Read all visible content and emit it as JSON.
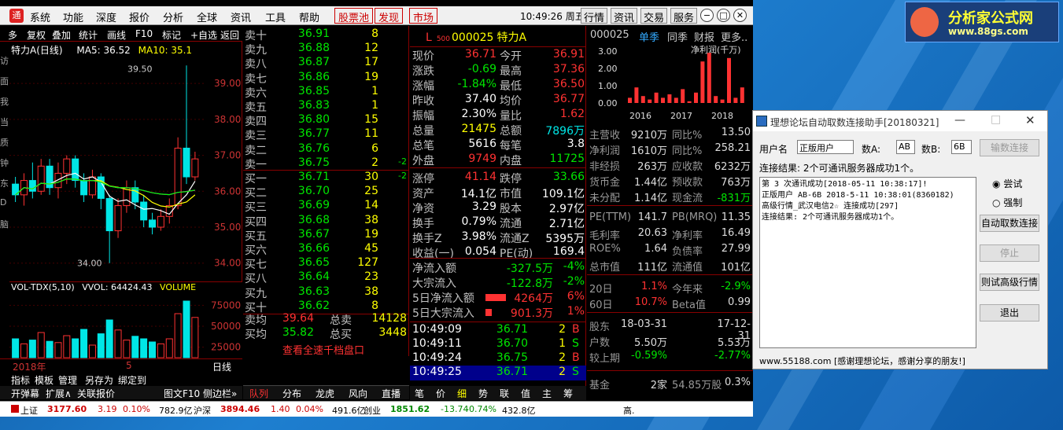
{
  "brand": {
    "name": "分析家公式网",
    "url": "www.88gs.com"
  },
  "menu": {
    "items": [
      "系统",
      "功能",
      "深度",
      "报价",
      "分析",
      "全球",
      "资讯",
      "工具",
      "帮助"
    ],
    "red_boxes": [
      "股票池",
      "发现",
      "市场"
    ],
    "time": "10:49:26 周五",
    "right_buttons": [
      "行情",
      "资讯",
      "交易",
      "服务"
    ]
  },
  "chart_toolbar": [
    "多",
    "复权",
    "叠加",
    "统计",
    "画线",
    "F10",
    "标记",
    "+自选",
    "返回"
  ],
  "left_strip": [
    "访",
    "面",
    "我",
    "当",
    "质",
    "钟",
    "东",
    "D",
    "脑"
  ],
  "kline": {
    "title": "特力A(日线)",
    "ma5_label": "MA5: 36.52",
    "ma10_label": "MA10: 35.1",
    "high_label": "39.50",
    "low_label": "34.00",
    "yticks": [
      "39.00",
      "38.00",
      "37.00",
      "36.00",
      "35.00",
      "34.00"
    ],
    "ylim": [
      33.6,
      39.9
    ]
  },
  "chart_data": {
    "type": "candlestick",
    "title": "特力A(日线)",
    "candles": [
      {
        "o": 36.2,
        "c": 35.9,
        "h": 36.4,
        "l": 35.7
      },
      {
        "o": 35.9,
        "c": 36.3,
        "h": 36.5,
        "l": 35.6
      },
      {
        "o": 36.3,
        "c": 36.0,
        "h": 36.8,
        "l": 35.8
      },
      {
        "o": 36.0,
        "c": 36.7,
        "h": 36.9,
        "l": 35.9
      },
      {
        "o": 36.7,
        "c": 36.1,
        "h": 36.9,
        "l": 35.9
      },
      {
        "o": 36.1,
        "c": 36.5,
        "h": 36.8,
        "l": 35.8
      },
      {
        "o": 36.5,
        "c": 36.9,
        "h": 37.0,
        "l": 36.2
      },
      {
        "o": 36.9,
        "c": 36.3,
        "h": 37.0,
        "l": 36.1
      },
      {
        "o": 36.3,
        "c": 35.9,
        "h": 36.5,
        "l": 35.7
      },
      {
        "o": 35.9,
        "c": 36.4,
        "h": 36.6,
        "l": 35.8
      },
      {
        "o": 36.4,
        "c": 35.8,
        "h": 36.5,
        "l": 35.5
      },
      {
        "o": 35.8,
        "c": 34.9,
        "h": 35.9,
        "l": 34.0
      },
      {
        "o": 34.9,
        "c": 35.6,
        "h": 35.8,
        "l": 34.7
      },
      {
        "o": 35.6,
        "c": 36.1,
        "h": 36.3,
        "l": 35.4
      },
      {
        "o": 36.1,
        "c": 35.7,
        "h": 36.3,
        "l": 35.5
      },
      {
        "o": 35.7,
        "c": 35.2,
        "h": 35.9,
        "l": 35.0
      },
      {
        "o": 35.2,
        "c": 35.0,
        "h": 35.4,
        "l": 34.8
      },
      {
        "o": 35.0,
        "c": 35.3,
        "h": 35.5,
        "l": 34.9
      },
      {
        "o": 35.3,
        "c": 35.6,
        "h": 35.8,
        "l": 35.1
      },
      {
        "o": 35.6,
        "c": 37.2,
        "h": 37.5,
        "l": 35.5
      },
      {
        "o": 37.2,
        "c": 36.4,
        "h": 39.5,
        "l": 36.2
      },
      {
        "o": 36.4,
        "c": 36.9,
        "h": 37.1,
        "l": 36.3
      }
    ],
    "vol": {
      "label": "VOL-TDX(5,10)",
      "vvol": "VVOL: 64424.43",
      "extra": "VOLUME",
      "values": [
        30,
        22,
        28,
        40,
        26,
        24,
        35,
        30,
        45,
        20,
        38,
        60,
        44,
        28,
        34,
        30,
        25,
        22,
        30,
        70,
        90,
        64
      ],
      "yticks": [
        "75000",
        "50000",
        "25000"
      ]
    }
  },
  "chart_bottom": {
    "date": "2018年",
    "mark": "5",
    "period": "日线"
  },
  "chart_tabs": [
    "指标",
    "模板",
    "管理",
    "另存为",
    "绑定到"
  ],
  "chart_tabs2": [
    "开弹幕",
    "扩展∧",
    "关联报价",
    "图文F10",
    "侧边栏»"
  ],
  "book": {
    "asks": [
      [
        "卖十",
        "36.91",
        "8"
      ],
      [
        "卖九",
        "36.88",
        "12"
      ],
      [
        "卖八",
        "36.87",
        "17"
      ],
      [
        "卖七",
        "36.86",
        "19"
      ],
      [
        "卖六",
        "36.85",
        "1"
      ],
      [
        "卖五",
        "36.83",
        "1"
      ],
      [
        "卖四",
        "36.80",
        "15"
      ],
      [
        "卖三",
        "36.77",
        "11"
      ],
      [
        "卖二",
        "36.76",
        "6"
      ],
      [
        "卖一",
        "36.75",
        "2",
        "-2"
      ]
    ],
    "bids": [
      [
        "买一",
        "36.71",
        "30",
        "-2"
      ],
      [
        "买二",
        "36.70",
        "25"
      ],
      [
        "买三",
        "36.69",
        "14"
      ],
      [
        "买四",
        "36.68",
        "38"
      ],
      [
        "买五",
        "36.67",
        "19"
      ],
      [
        "买六",
        "36.66",
        "45"
      ],
      [
        "买七",
        "36.65",
        "127"
      ],
      [
        "买八",
        "36.64",
        "23"
      ],
      [
        "买九",
        "36.63",
        "38"
      ],
      [
        "买十",
        "36.62",
        "8"
      ]
    ],
    "avg_sell": {
      "label": "卖均",
      "price": "39.64",
      "tlabel": "总卖",
      "vol": "14128"
    },
    "avg_buy": {
      "label": "买均",
      "price": "35.82",
      "tlabel": "总买",
      "vol": "3448"
    },
    "link": "查看全速千档盘口"
  },
  "book_tabs": [
    "队列",
    "分布",
    "龙虎",
    "风向",
    "直播"
  ],
  "quote": {
    "code": "000025",
    "name": "特力A",
    "prefix": "L",
    "sub": "500",
    "rows": [
      [
        "现价",
        "36.71",
        "今开",
        "36.91"
      ],
      [
        "涨跌",
        "-0.69",
        "最高",
        "37.36"
      ],
      [
        "涨幅",
        "-1.84%",
        "最低",
        "36.50"
      ],
      [
        "昨收",
        "37.40",
        "均价",
        "36.77"
      ],
      [
        "振幅",
        "2.30%",
        "量比",
        "1.62"
      ],
      [
        "总量",
        "21475",
        "总额",
        "7896万"
      ],
      [
        "总笔",
        "5616",
        "每笔",
        "3.8"
      ],
      [
        "外盘",
        "9749",
        "内盘",
        "11725"
      ],
      [
        "涨停",
        "41.14",
        "跌停",
        "33.66"
      ],
      [
        "资产",
        "14.1亿",
        "市值",
        "109.1亿"
      ],
      [
        "净资",
        "3.29",
        "股本",
        "2.97亿"
      ],
      [
        "换手",
        "0.79%",
        "流通",
        "2.71亿"
      ],
      [
        "换手Z",
        "3.98%",
        "流通Z",
        "5395万"
      ],
      [
        "收益(一)",
        "0.054",
        "PE(动)",
        "169.4"
      ]
    ],
    "flow": [
      [
        "净流入额",
        "-327.5万",
        "-4%"
      ],
      [
        "大宗流入",
        "-122.8万",
        "-2%"
      ],
      [
        "5日净流入额",
        "4264万",
        "6%"
      ],
      [
        "5日大宗流入",
        "901.3万",
        "1%"
      ]
    ],
    "ticks": [
      [
        "10:49:09",
        "36.71",
        "2",
        "B"
      ],
      [
        "10:49:11",
        "36.70",
        "1",
        "S"
      ],
      [
        "10:49:24",
        "36.75",
        "2",
        "B"
      ],
      [
        "10:49:25",
        "36.71",
        "2",
        "S"
      ]
    ],
    "tabs": [
      "笔",
      "价",
      "细",
      "势",
      "联",
      "值",
      "主",
      "筹"
    ]
  },
  "fin": {
    "header": [
      "000025",
      "单季",
      "同季",
      "财报",
      "更多.."
    ],
    "profit_chart": {
      "title": "净利润(千万)",
      "yticks": [
        "3.00",
        "2.00",
        "1.00",
        "0.00"
      ],
      "years": [
        "2016",
        "2017",
        "2018"
      ],
      "values": [
        0.3,
        0.9,
        0.4,
        0.2,
        0.6,
        0.3,
        0.5,
        0.3,
        0.8,
        0.1,
        0.6,
        2.4,
        2.9,
        0.4,
        0.2,
        2.6,
        0.3,
        0.9
      ]
    },
    "rows": [
      [
        "主营收",
        "9210万",
        "同比%",
        "13.50"
      ],
      [
        "净利润",
        "1610万",
        "同比%",
        "258.21"
      ],
      [
        "非经损",
        "263万",
        "应收款",
        "6232万"
      ],
      [
        "货币金",
        "1.44亿",
        "预收款",
        "763万"
      ],
      [
        "未分配",
        "1.14亿",
        "现金流",
        "-831万"
      ],
      [
        "PE(TTM)",
        "141.7",
        "PB(MRQ)",
        "11.35"
      ],
      [
        "毛利率",
        "20.63",
        "净利率",
        "16.49"
      ],
      [
        "ROE%",
        "1.64",
        "负债率",
        "27.99"
      ],
      [
        "总市值",
        "111亿",
        "流通值",
        "101亿"
      ],
      [
        "20日",
        "1.1%",
        "今年来",
        "-2.9%"
      ],
      [
        "60日",
        "10.7%",
        "Beta值",
        "0.99"
      ],
      [
        "股东",
        "18-03-31",
        "",
        "17-12-31"
      ],
      [
        "户数",
        "5.50万",
        "",
        "5.53万"
      ],
      [
        "较上期",
        "-0.59%",
        "",
        "-2.77%"
      ],
      [
        "基金",
        "2家",
        "54.85万股",
        "0.3%"
      ]
    ]
  },
  "statusbar": {
    "sh": [
      "上证",
      "3177.60",
      "3.19",
      "0.10%",
      "782.9亿"
    ],
    "sz": [
      "沪深",
      "3894.46",
      "1.40",
      "0.04%",
      "491.6亿"
    ],
    "cy": [
      "创业",
      "1851.62",
      "-13.74",
      "-0.74%",
      "432.8亿"
    ],
    "extra": "高."
  },
  "dialog": {
    "title": "理想论坛自动取数连接助手[20180321]",
    "user_label": "用户名",
    "user_value": "正版用户",
    "a_label": "数A:",
    "a_value": "AB",
    "b_label": "数B:",
    "b_value": "6B",
    "status": "连接结果: 2个可通讯服务器成功1个。",
    "log": [
      "第 3 次通讯成功[2018-05-11 10:38:17]!",
      "正版用户 AB-6B 2018-5-11 10:38:01(8360182)",
      "高级行情_武汉电信2☆      连接成功[297]",
      "连接结果: 2个可通讯服务器成功1个。"
    ],
    "footer": "www.55188.com [感谢理想论坛，感谢分享的朋友!]",
    "buttons": [
      "输数连接",
      "自动取数连接",
      "停止",
      "则试高级行情",
      "退出"
    ],
    "radios": [
      "尝试",
      "强制"
    ]
  }
}
